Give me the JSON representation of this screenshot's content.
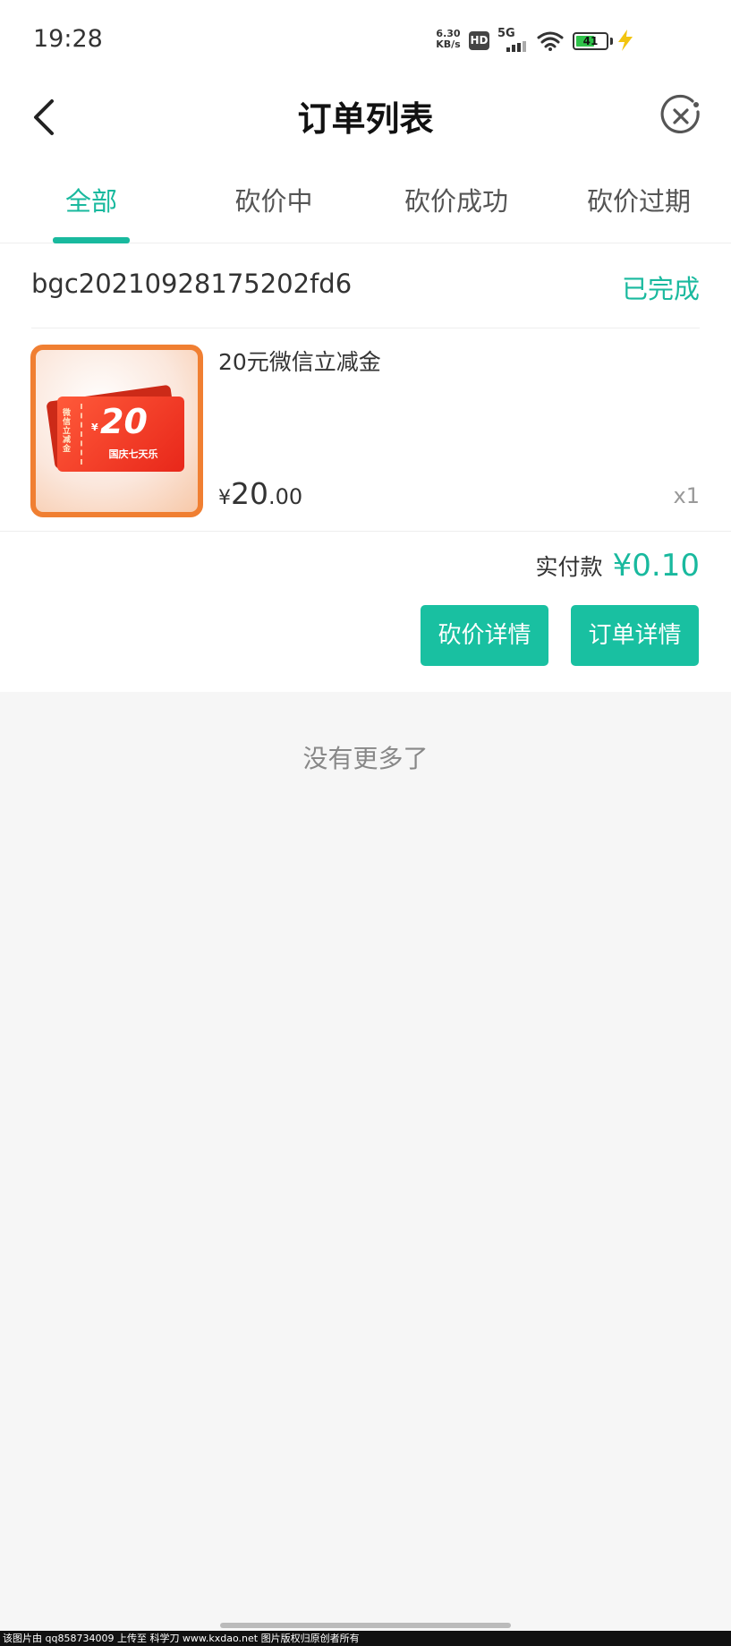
{
  "status_bar": {
    "time": "19:28",
    "net_speed_value": "6.30",
    "net_speed_unit": "KB/s",
    "hd_badge": "HD",
    "network": "5G",
    "battery_level": "41",
    "icons": [
      "signal-icon",
      "wifi-icon",
      "battery-icon",
      "charging-icon"
    ]
  },
  "nav": {
    "title": "订单列表",
    "back_icon": "chevron-left-icon",
    "close_icon": "close-circle-icon"
  },
  "tabs": [
    {
      "label": "全部",
      "active": true
    },
    {
      "label": "砍价中",
      "active": false
    },
    {
      "label": "砍价成功",
      "active": false
    },
    {
      "label": "砍价过期",
      "active": false
    }
  ],
  "order": {
    "id": "bgc20210928175202fd6",
    "status": "已完成",
    "product": {
      "name": "20元微信立减金",
      "price_currency": "¥",
      "price_integer": "20",
      "price_decimal": ".00",
      "quantity": "x1",
      "thumbnail": {
        "side_text": "微信立减金",
        "currency": "¥",
        "amount": "20",
        "caption": "国庆七天乐"
      }
    },
    "paid_label": "实付款",
    "paid_amount": "¥0.10",
    "actions": {
      "bargain_details": "砍价详情",
      "order_details": "订单详情"
    }
  },
  "footer": {
    "no_more": "没有更多了",
    "watermark": "该图片由 qq858734009 上传至 科学刀 www.kxdao.net 图片版权归原创者所有"
  },
  "colors": {
    "accent": "#19b99e",
    "button": "#19c0a1",
    "thumb_border": "#f07f32",
    "coupon_red": "#e8271a"
  }
}
